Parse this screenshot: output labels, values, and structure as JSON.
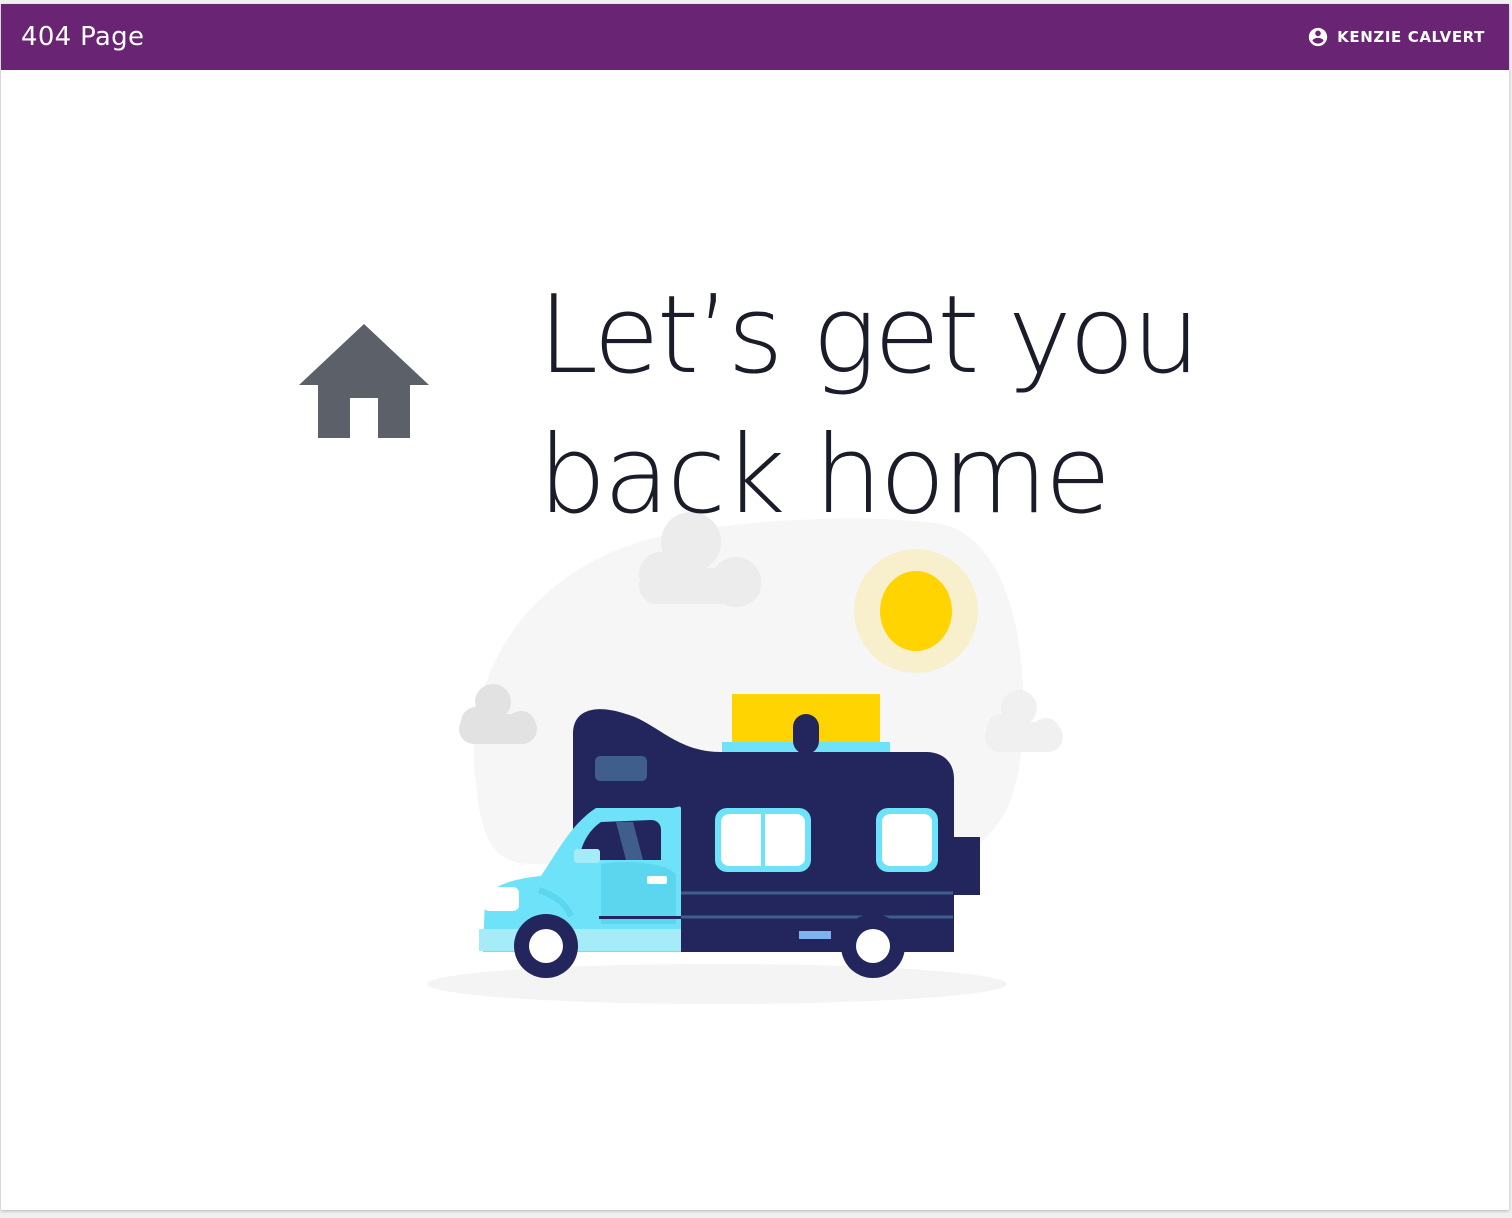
{
  "header": {
    "title": "404 Page",
    "user_name": "KENZIE CALVERT",
    "background_color": "#6a2474"
  },
  "main": {
    "headline_line1": "Let’s get you",
    "headline_line2": "back home",
    "home_icon": "home-icon",
    "illustration": "camper-van-illustration"
  }
}
